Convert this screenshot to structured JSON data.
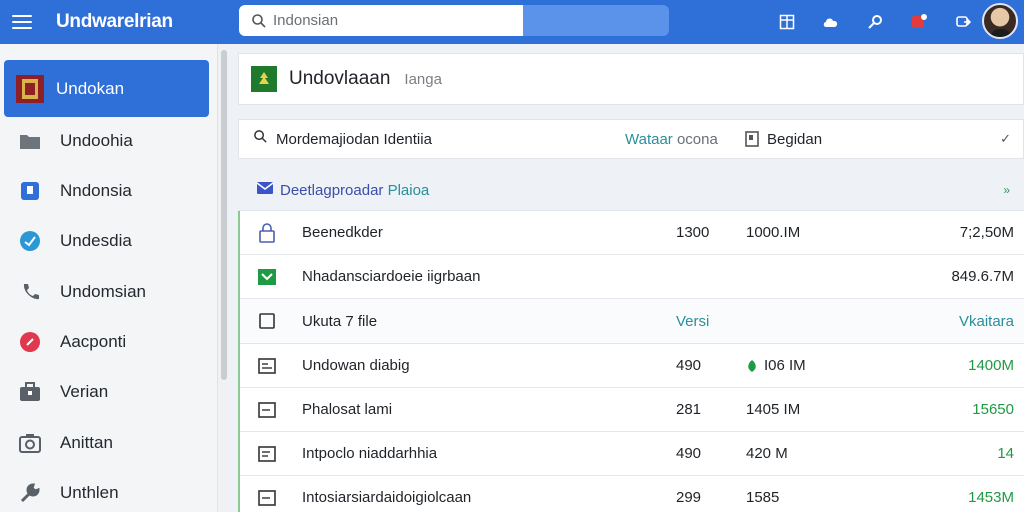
{
  "topbar": {
    "title": "Undwarelrian",
    "search_placeholder": "Indonsian",
    "icons": [
      "layout-icon",
      "cloud-icon",
      "key-icon",
      "notification-icon",
      "share-icon"
    ],
    "accent": "#2f6fd8"
  },
  "sidebar": {
    "items": [
      {
        "label": "Undokan",
        "icon": "flag-icon",
        "active": true
      },
      {
        "label": "Undoohia",
        "icon": "folder-icon"
      },
      {
        "label": "Nndonsia",
        "icon": "document-icon"
      },
      {
        "label": "Undesdia",
        "icon": "shield-icon"
      },
      {
        "label": "Undomsian",
        "icon": "phone-icon"
      },
      {
        "label": "Aacponti",
        "icon": "record-icon"
      },
      {
        "label": "Verian",
        "icon": "briefcase-icon"
      },
      {
        "label": "Anittan",
        "icon": "camera-icon"
      },
      {
        "label": "Unthlen",
        "icon": "wrench-icon"
      }
    ]
  },
  "header": {
    "title": "Undovlaaan",
    "subtitle": "Ianga"
  },
  "filter": {
    "query": "Mordemajiodan Identiia",
    "link_main": "Wataar",
    "link_tail": "ocona",
    "select_label": "Begidan"
  },
  "group": {
    "label_main": "Deetlagproadar",
    "label_tail": "Plaioa"
  },
  "rows": [
    {
      "name": "Beenedkder",
      "c1": "1300",
      "c2": "1000.IM",
      "c3": "7;2,50M",
      "icon": "lock-icon"
    },
    {
      "name": "Nhadansciardoeie iigrbaan",
      "c1": "",
      "c2": "",
      "c3": "849.6.7M",
      "icon": "checkbox-icon"
    },
    {
      "name": "Ukuta 7 file",
      "c1": "Versi",
      "c2": "",
      "c3": "Vkaitara",
      "icon": "empty-checkbox-icon",
      "header": true
    },
    {
      "name": "Undowan diabig",
      "c1": "490",
      "c2": "I06 IM",
      "c3": "1400M",
      "icon": "file-icon",
      "c2icon": true
    },
    {
      "name": "Phalosat lami",
      "c1": "281",
      "c2": "1405 IM",
      "c3": "15650",
      "icon": "file-icon"
    },
    {
      "name": "Intpoclo niaddarhhia",
      "c1": "490",
      "c2": "420 M",
      "c3": "14",
      "icon": "file-icon"
    },
    {
      "name": "Intosiarsiardaidoigiolcaan",
      "c1": "299",
      "c2": "1585",
      "c3": "1453M",
      "icon": "file-icon"
    }
  ]
}
